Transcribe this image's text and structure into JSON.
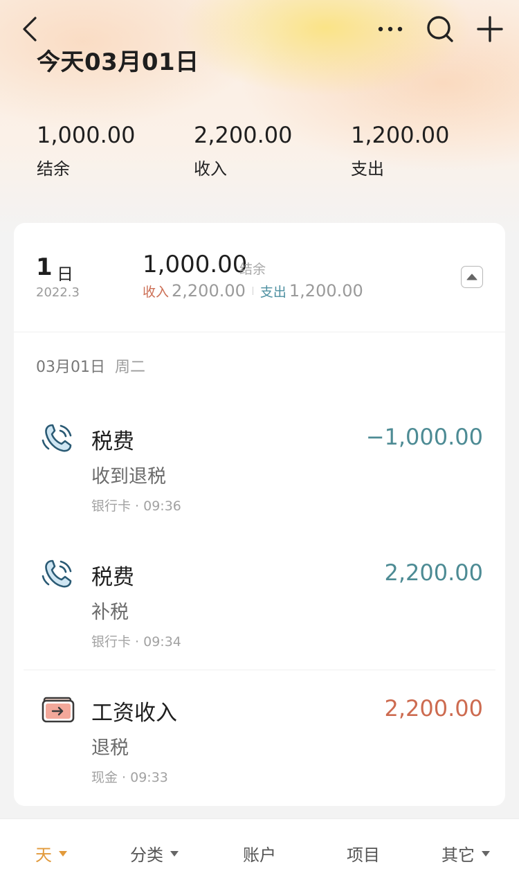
{
  "header": {
    "title": "今天03月01日",
    "icons": [
      "back-icon",
      "more-icon",
      "search-icon",
      "add-icon"
    ]
  },
  "summary": [
    {
      "value": "1,000.00",
      "label": "结余"
    },
    {
      "value": "2,200.00",
      "label": "收入"
    },
    {
      "value": "1,200.00",
      "label": "支出"
    }
  ],
  "day": {
    "num": "1",
    "unit": "日",
    "year_month": "2022.3",
    "balance": "1,000.00",
    "balance_label": "结余",
    "income_label": "收入",
    "income": "2,200.00",
    "expense_label": "支出",
    "expense": "1,200.00"
  },
  "date_header": {
    "date": "03月01日",
    "weekday": "周二"
  },
  "transactions": [
    {
      "icon": "phone-icon",
      "category": "税费",
      "note": "收到退税",
      "meta": "银行卡 · 09:36",
      "amount": "−1,000.00",
      "color": "#4d8b94"
    },
    {
      "icon": "phone-icon",
      "category": "税费",
      "note": "补税",
      "meta": "银行卡 · 09:34",
      "amount": "2,200.00",
      "color": "#4d8b94"
    },
    {
      "icon": "wallet-icon",
      "category": "工资收入",
      "note": "退税",
      "meta": "现金 · 09:33",
      "amount": "2,200.00",
      "color": "#cd6b50"
    }
  ],
  "tabs": [
    {
      "label": "天",
      "active": true,
      "has_dropdown": true
    },
    {
      "label": "分类",
      "active": false,
      "has_dropdown": true
    },
    {
      "label": "账户",
      "active": false,
      "has_dropdown": false
    },
    {
      "label": "项目",
      "active": false,
      "has_dropdown": false
    },
    {
      "label": "其它",
      "active": false,
      "has_dropdown": true
    }
  ],
  "colors": {
    "accent": "#e29a3b",
    "income": "#cd6b50",
    "expense": "#4d8b94"
  }
}
